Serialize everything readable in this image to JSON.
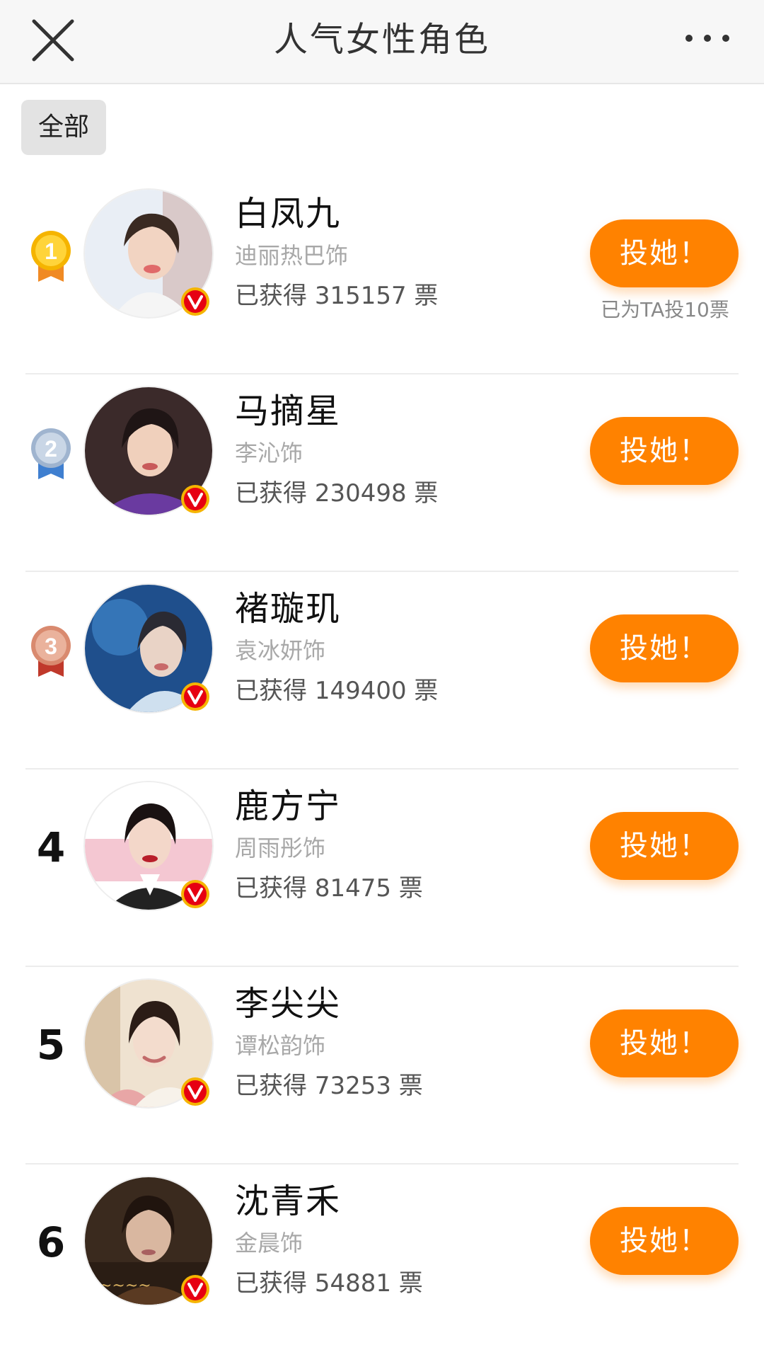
{
  "header": {
    "title": "人气女性角色",
    "close_icon": "close-icon",
    "more_icon": "more-horizontal-icon"
  },
  "filter": {
    "active_label": "全部"
  },
  "colors": {
    "accent": "#ff8200",
    "gold": "#f5b400",
    "silver": "#9fb4cf",
    "bronze": "#d98a6f",
    "verify": "#e60012"
  },
  "rankings": [
    {
      "rank": "1",
      "name": "白凤九",
      "actor": "迪丽热巴饰",
      "votes_prefix": "已获得",
      "votes": "315157",
      "votes_suffix": "票",
      "vote_label": "投她！",
      "voted_note": "已为TA投10票"
    },
    {
      "rank": "2",
      "name": "马摘星",
      "actor": "李沁饰",
      "votes_prefix": "已获得",
      "votes": "230498",
      "votes_suffix": "票",
      "vote_label": "投她！"
    },
    {
      "rank": "3",
      "name": "褚璇玑",
      "actor": "袁冰妍饰",
      "votes_prefix": "已获得",
      "votes": "149400",
      "votes_suffix": "票",
      "vote_label": "投她！"
    },
    {
      "rank": "4",
      "name": "鹿方宁",
      "actor": "周雨彤饰",
      "votes_prefix": "已获得",
      "votes": "81475",
      "votes_suffix": "票",
      "vote_label": "投她！"
    },
    {
      "rank": "5",
      "name": "李尖尖",
      "actor": "谭松韵饰",
      "votes_prefix": "已获得",
      "votes": "73253",
      "votes_suffix": "票",
      "vote_label": "投她！"
    },
    {
      "rank": "6",
      "name": "沈青禾",
      "actor": "金晨饰",
      "votes_prefix": "已获得",
      "votes": "54881",
      "votes_suffix": "票",
      "vote_label": "投她！"
    }
  ]
}
